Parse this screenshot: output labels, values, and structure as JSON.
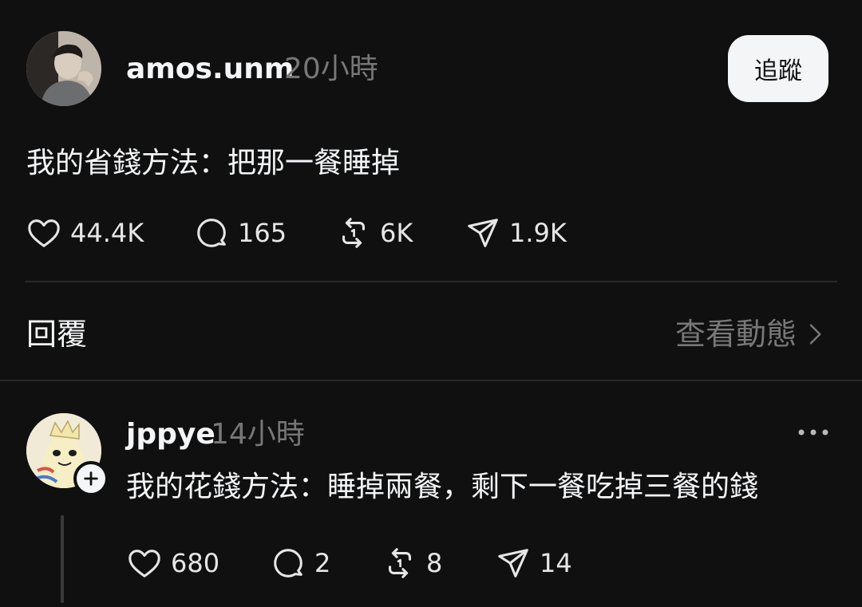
{
  "post": {
    "username": "amos.unm",
    "time": "20小時",
    "follow_label": "追蹤",
    "text": "我的省錢方法：把那一餐睡掉",
    "stats": {
      "likes": "44.4K",
      "comments": "165",
      "reposts": "6K",
      "shares": "1.9K"
    }
  },
  "replies_section": {
    "label": "回覆",
    "view_activity": "查看動態"
  },
  "reply": {
    "username": "jppye",
    "time": "14小時",
    "text": "我的花錢方法：睡掉兩餐，剩下一餐吃掉三餐的錢",
    "stats": {
      "likes": "680",
      "comments": "2",
      "reposts": "8",
      "shares": "14"
    }
  },
  "icons": {
    "like": "heart-icon",
    "comment": "speech-bubble-icon",
    "repost": "repost-icon",
    "share": "send-icon",
    "more": "more-dots-icon",
    "chevron": "chevron-right-icon",
    "follow_plus": "plus-icon"
  },
  "colors": {
    "background": "#101010",
    "text_primary": "#f3f5f7",
    "text_secondary": "#777777",
    "divider": "#2a2a2a",
    "button_bg": "#f3f5f7"
  }
}
